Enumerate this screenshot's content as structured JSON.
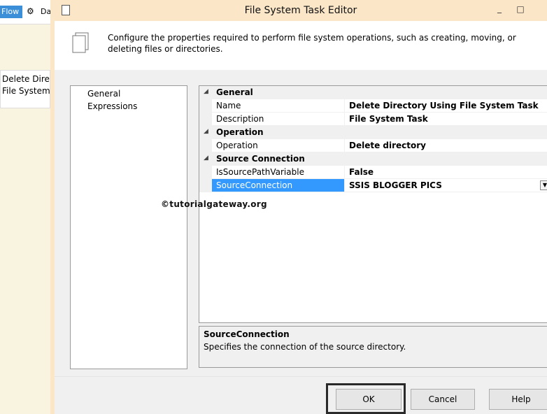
{
  "background": {
    "flow_tab": "Flow",
    "data_flow_tab": "Da",
    "task_lines": [
      "Delete Dire",
      "File System"
    ]
  },
  "window": {
    "title": "File System Task Editor",
    "minimize_glyph": "_",
    "maximize_glyph": "□"
  },
  "header": {
    "description": "Configure the properties required to perform file system operations, such as creating, moving, or deleting files or directories."
  },
  "nav": {
    "items": [
      {
        "label": "General",
        "selected": true
      },
      {
        "label": "Expressions",
        "selected": false
      }
    ]
  },
  "grid": {
    "categories": [
      {
        "label": "General",
        "properties": [
          {
            "name": "Name",
            "value": "Delete Directory Using File System Task"
          },
          {
            "name": "Description",
            "value": "File System Task"
          }
        ]
      },
      {
        "label": "Operation",
        "properties": [
          {
            "name": "Operation",
            "value": "Delete directory"
          }
        ]
      },
      {
        "label": "Source Connection",
        "properties": [
          {
            "name": "IsSourcePathVariable",
            "value": "False"
          },
          {
            "name": "SourceConnection",
            "value": "SSIS BLOGGER PICS",
            "selected": true
          }
        ]
      }
    ]
  },
  "watermark": "©tutorialgateway.org",
  "help": {
    "title": "SourceConnection",
    "text": "Specifies the connection of the source directory."
  },
  "buttons": {
    "ok": "OK",
    "cancel": "Cancel",
    "help": "Help"
  },
  "colors": {
    "titlebar": "#fbe6c8",
    "selection": "#3399ff",
    "flow_tab": "#3b8fd8"
  }
}
